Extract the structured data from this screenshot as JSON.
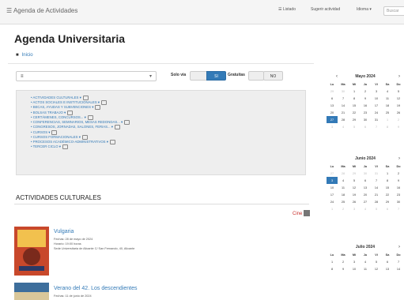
{
  "topbar": {
    "brand": "☰ Agenda de Actividades",
    "btn1": "☰ Listado",
    "btn2": "Sugerir actividad",
    "btn3": "Idioma ▾",
    "search_placeholder": "Buscar"
  },
  "page": {
    "title": "Agenda Universitaria",
    "breadcrumb_home_icon": "home-icon",
    "breadcrumb": "Inicio",
    "section_title": "ACTIVIDADES CULTURALES",
    "cine_label": "Cine"
  },
  "filters": {
    "select_value": "≡",
    "lbl_from": "Solo vía",
    "toggle_si": "SI",
    "lbl_gratis": "Gratuitas",
    "toggle_no": "NO"
  },
  "categories": [
    "ACTIVIDADES CULTURALES ▾",
    "ACTOS SOCIALES E INSTITUCIONALES ▾",
    "BECAS, AYUDAS Y SUBVENCIONES ▾",
    "BOLSAS TRABAJO ▾",
    "CERTÁMENES, CONCURSOS... ▾",
    "CONFERENCIAS, SEMINARIOS, MESAS REDONDAS... ▾",
    "CONGRESOS, JORNADAS, SALONES, FERIAS... ▾",
    "CURSOS ▾",
    "CURSOS FORMACIONALES ▾",
    "PROCESOS ACADÉMICO-ADMINISTRATIVOS ▾",
    "TERCER CICLO ▾"
  ],
  "events": [
    {
      "title": "Vulgaria",
      "line1": "Fechas: 28 de mayo de 2024",
      "line2": "Horario: 19:00 horas",
      "line3": "Sede Universitaria de Alicante C/ San Fernando, 40, Alicante"
    },
    {
      "title": "Verano del 42. Los descendientes",
      "line1": "Fechas: 11 de junio de 2024",
      "line2": "",
      "line3": ""
    }
  ],
  "calendars": [
    {
      "month": "Mayo 2024",
      "weekdays": [
        "Lu",
        "Ma",
        "Mi",
        "Ju",
        "Vi",
        "Sa",
        "Do"
      ],
      "rows": [
        [
          "29",
          "30",
          "1",
          "2",
          "3",
          "4",
          "5"
        ],
        [
          "6",
          "7",
          "8",
          "9",
          "10",
          "11",
          "12"
        ],
        [
          "13",
          "14",
          "15",
          "16",
          "17",
          "18",
          "19"
        ],
        [
          "20",
          "21",
          "22",
          "23",
          "24",
          "25",
          "26"
        ],
        [
          "27",
          "28",
          "29",
          "30",
          "31",
          "1",
          "2"
        ],
        [
          "3",
          "4",
          "5",
          "6",
          "7",
          "8",
          "9"
        ]
      ]
    },
    {
      "month": "Junio 2024",
      "weekdays": [
        "Lu",
        "Ma",
        "Mi",
        "Ju",
        "Vi",
        "Sa",
        "Do"
      ],
      "rows": [
        [
          "27",
          "28",
          "29",
          "30",
          "31",
          "1",
          "2"
        ],
        [
          "3",
          "4",
          "5",
          "6",
          "7",
          "8",
          "9"
        ],
        [
          "10",
          "11",
          "12",
          "13",
          "14",
          "15",
          "16"
        ],
        [
          "17",
          "18",
          "19",
          "20",
          "21",
          "22",
          "23"
        ],
        [
          "24",
          "25",
          "26",
          "27",
          "28",
          "29",
          "30"
        ],
        [
          "1",
          "2",
          "3",
          "4",
          "5",
          "6",
          "7"
        ]
      ]
    },
    {
      "month": "Julio 2024",
      "weekdays": [
        "Lu",
        "Ma",
        "Mi",
        "Ju",
        "Vi",
        "Sa",
        "Do"
      ],
      "rows": [
        [
          "1",
          "2",
          "3",
          "4",
          "5",
          "6",
          "7"
        ],
        [
          "8",
          "9",
          "10",
          "11",
          "12",
          "13",
          "14"
        ]
      ]
    }
  ],
  "colors": {
    "accent": "#337ab7",
    "panel": "#eeeeee"
  }
}
